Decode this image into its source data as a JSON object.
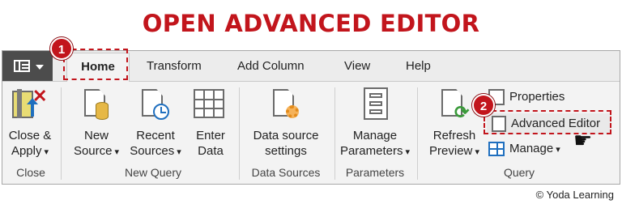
{
  "title": "OPEN ADVANCED EDITOR",
  "tabs": [
    "Home",
    "Transform",
    "Add Column",
    "View",
    "Help"
  ],
  "buttons": {
    "close_apply": [
      "Close &",
      "Apply"
    ],
    "new_source": [
      "New",
      "Source"
    ],
    "recent_sources": [
      "Recent",
      "Sources"
    ],
    "enter_data": [
      "Enter",
      "Data"
    ],
    "data_source_settings": [
      "Data source",
      "settings"
    ],
    "manage_parameters": [
      "Manage",
      "Parameters"
    ],
    "refresh_preview": [
      "Refresh",
      "Preview"
    ],
    "properties": "Properties",
    "advanced_editor": "Advanced Editor",
    "manage": "Manage"
  },
  "groups": [
    "Close",
    "New Query",
    "Data Sources",
    "Parameters",
    "Query"
  ],
  "badges": [
    "1",
    "2"
  ],
  "credit": "© Yoda Learning",
  "colors": {
    "accent": "#c2151c",
    "file_button": "#4c4c4c",
    "ribbon_bg": "#f3f3f3"
  }
}
